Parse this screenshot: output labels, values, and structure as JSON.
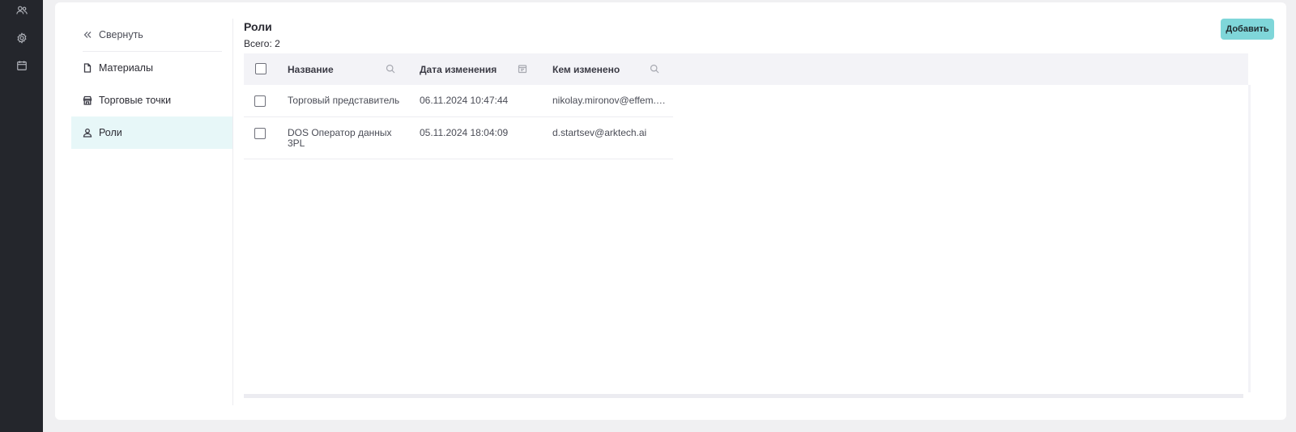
{
  "rail": {
    "icons": [
      "users-icon",
      "settings-icon",
      "calendar-icon"
    ]
  },
  "sidebar": {
    "collapse_label": "Свернуть",
    "items": [
      {
        "label": "Материалы",
        "icon": "document-icon"
      },
      {
        "label": "Торговые точки",
        "icon": "store-icon"
      },
      {
        "label": "Роли",
        "icon": "user-icon",
        "active": true
      }
    ]
  },
  "main": {
    "title": "Роли",
    "total": "Всего: 2",
    "add_label": "Добавить"
  },
  "table": {
    "columns": [
      {
        "label": "Название",
        "filter_icon": "search-icon"
      },
      {
        "label": "Дата изменения",
        "filter_icon": "calendar-icon"
      },
      {
        "label": "Кем изменено",
        "filter_icon": "search-icon"
      }
    ],
    "rows": [
      {
        "name": "Торговый представитель",
        "date": "06.11.2024 10:47:44",
        "by": "nikolay.mironov@effem.c…"
      },
      {
        "name": "DOS Оператор данных 3PL",
        "date": "05.11.2024 18:04:09",
        "by": "d.startsev@arktech.ai"
      }
    ]
  },
  "colors": {
    "accent": "#7fd6d9",
    "active_bg": "#e7f7f8",
    "rail_bg": "#24262c",
    "header_bg": "#f3f3f7"
  }
}
